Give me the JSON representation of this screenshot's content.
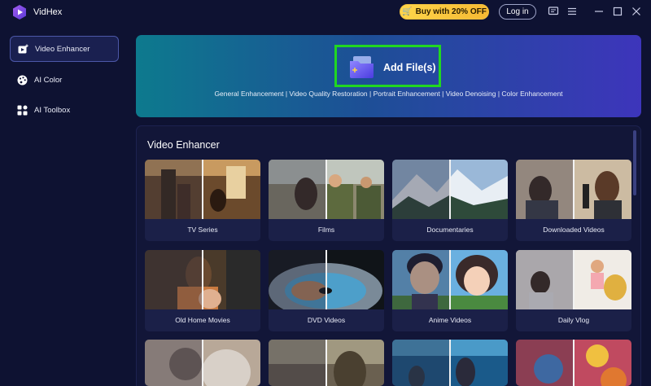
{
  "app": {
    "name": "VidHex"
  },
  "titlebar": {
    "buy_label": "Buy with 20% OFF",
    "login_label": "Log in"
  },
  "sidebar": {
    "items": [
      {
        "label": "Video Enhancer",
        "icon": "video-plus-icon",
        "active": true
      },
      {
        "label": "AI Color",
        "icon": "palette-icon",
        "active": false
      },
      {
        "label": "AI Toolbox",
        "icon": "toolbox-grid-icon",
        "active": false
      }
    ]
  },
  "banner": {
    "add_label": "Add File(s)",
    "features": "General Enhancement | Video Quality Restoration | Portrait Enhancement | Video Denoising | Color Enhancement"
  },
  "section": {
    "title": "Video Enhancer",
    "cards": [
      {
        "label": "TV Series"
      },
      {
        "label": "Films"
      },
      {
        "label": "Documentaries"
      },
      {
        "label": "Downloaded Videos"
      },
      {
        "label": "Old Home Movies"
      },
      {
        "label": "DVD Videos"
      },
      {
        "label": "Anime Videos"
      },
      {
        "label": "Daily Vlog"
      }
    ]
  },
  "colors": {
    "background": "#0e1232",
    "accent": "#4c57a8",
    "highlight": "#21d721",
    "buy": "#f6b933"
  }
}
